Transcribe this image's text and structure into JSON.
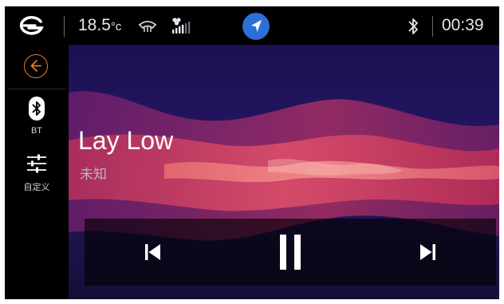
{
  "status_bar": {
    "brand_logo_icon": "brand-logo-icon",
    "temperature_value": "18.5",
    "temperature_unit": "°c",
    "defrost_icon": "rear-defrost-icon",
    "fan_icon": "fan-speed-icon",
    "navigation_icon": "navigation-arrow-icon",
    "bluetooth_icon": "bluetooth-icon",
    "time": "00:39"
  },
  "sidebar": {
    "back_icon": "back-arrow-icon",
    "items": [
      {
        "label": "BT",
        "icon": "bluetooth-icon"
      },
      {
        "label": "自定义",
        "icon": "equalizer-sliders-icon"
      }
    ]
  },
  "player": {
    "track_title": "Lay Low",
    "artist": "未知",
    "state": "playing",
    "controls": {
      "previous_icon": "skip-previous-icon",
      "pause_icon": "pause-icon",
      "next_icon": "skip-next-icon"
    }
  },
  "colors": {
    "accent_orange": "#e57a2b",
    "nav_blue": "#2c6fd6",
    "wave_pink": "#d0345f",
    "background_purple": "#231560"
  }
}
